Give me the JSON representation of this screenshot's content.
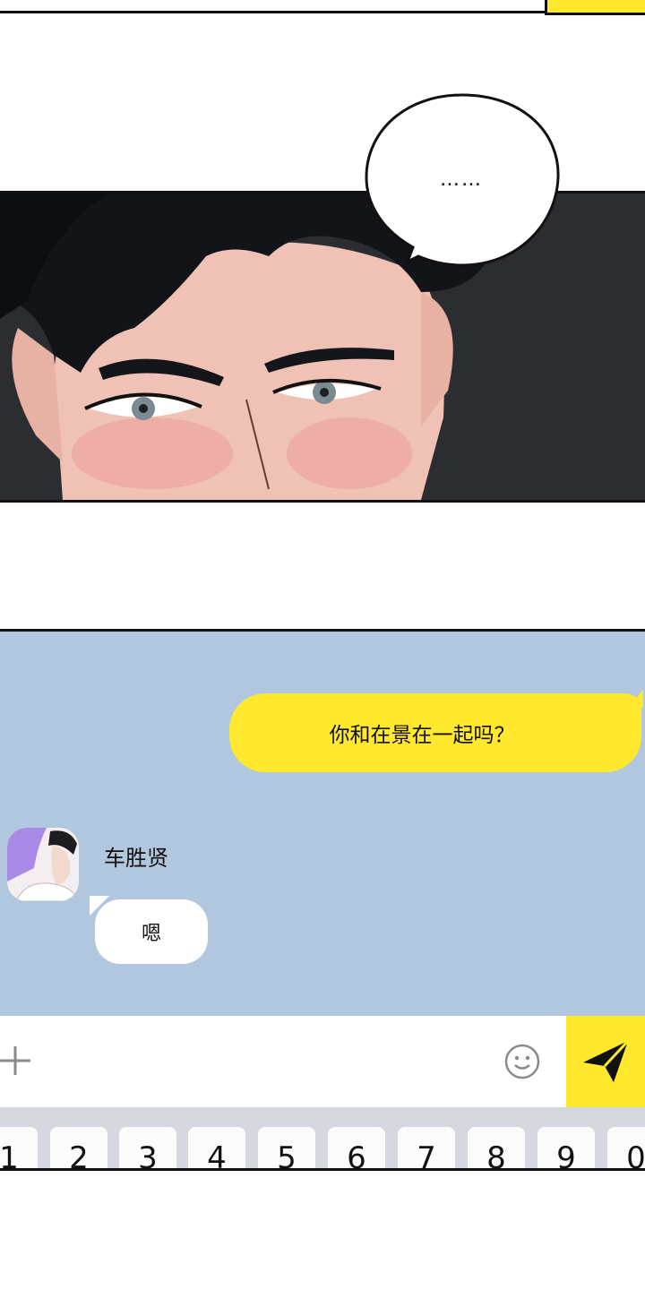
{
  "balloon": {
    "text": "……"
  },
  "chat": {
    "my_message": "你和在景在一起吗？",
    "sender_name": "车胜贤",
    "reply": "嗯"
  },
  "input": {
    "plus_icon": "plus-icon",
    "emoji_icon": "smile-icon",
    "send_icon": "send-icon"
  },
  "keyboard": {
    "keys": [
      "1",
      "2",
      "3",
      "4",
      "5",
      "6",
      "7",
      "8",
      "9",
      "0"
    ]
  },
  "colors": {
    "accent_yellow": "#ffe82e",
    "chat_bg": "#b1c7dd",
    "panel_dark": "#2b2d31"
  }
}
